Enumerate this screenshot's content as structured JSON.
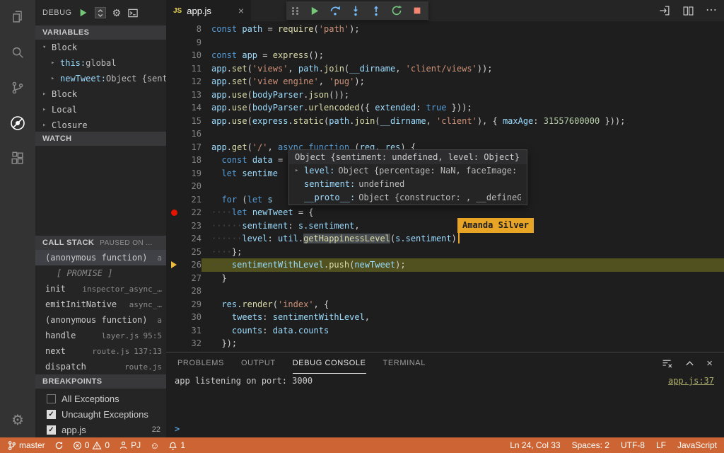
{
  "colors": {
    "status_bar_bg": "#CC6533",
    "exec_line_highlight": "#51511F",
    "collab_cursor": "#E8A425",
    "breakpoint_red": "#E51400"
  },
  "icons": {
    "gear": "⚙",
    "more": "⋯",
    "close": "×",
    "check": "✓",
    "smiley": "☺"
  },
  "sidebar": {
    "debug_title": "DEBUG",
    "variables": {
      "title": "VARIABLES",
      "rows": [
        {
          "twistie": "▾",
          "label": "Block",
          "indent": 0
        },
        {
          "twistie": "▸",
          "name": "this:",
          "value": "global",
          "indent": 1
        },
        {
          "twistie": "▸",
          "name": "newTweet:",
          "value": "Object {sent…",
          "indent": 1
        },
        {
          "twistie": "▸",
          "label": "Block",
          "indent": 0
        },
        {
          "twistie": "▸",
          "label": "Local",
          "indent": 0
        },
        {
          "twistie": "▸",
          "label": "Closure",
          "indent": 0
        }
      ]
    },
    "watch": {
      "title": "WATCH"
    },
    "call_stack": {
      "title": "CALL STACK",
      "badge": "PAUSED ON ...",
      "frames": [
        {
          "name": "(anonymous function)",
          "file": "a",
          "selected": true
        },
        {
          "name": "[ PROMISE ]",
          "promise": true
        },
        {
          "name": "init",
          "file": "inspector_async_…"
        },
        {
          "name": "emitInitNative",
          "file": "async_…"
        },
        {
          "name": "(anonymous function)",
          "file": "a"
        },
        {
          "name": "handle",
          "file": "layer.js",
          "loc": "95:5"
        },
        {
          "name": "next",
          "file": "route.js",
          "loc": "137:13"
        },
        {
          "name": "dispatch",
          "file": "route.js"
        }
      ]
    },
    "breakpoints": {
      "title": "BREAKPOINTS",
      "items": [
        {
          "checked": false,
          "label": "All Exceptions"
        },
        {
          "checked": true,
          "label": "Uncaught Exceptions"
        },
        {
          "checked": true,
          "label": "app.js",
          "badge": "22"
        }
      ]
    }
  },
  "editor": {
    "tab": {
      "icon_label": "JS",
      "title": "app.js",
      "close_label": "×"
    },
    "collab_cursor_name": "Amanda Silver",
    "tooltip": {
      "header": "Object {sentiment: undefined, level: Object}",
      "rows": [
        {
          "twistie": "▸",
          "name": "level:",
          "value": "Object {percentage: NaN, faceImage: \"/a"
        },
        {
          "name": "sentiment:",
          "value": "undefined"
        },
        {
          "name": "__proto__:",
          "value": "Object {constructor: , __defineGette"
        }
      ]
    },
    "lines": [
      {
        "num": 8,
        "tokens": [
          {
            "t": "const ",
            "c": "k"
          },
          {
            "t": "path",
            "c": "v"
          },
          {
            "t": " = ",
            "c": "p"
          },
          {
            "t": "require",
            "c": "f"
          },
          {
            "t": "(",
            "c": "p"
          },
          {
            "t": "'path'",
            "c": "s"
          },
          {
            "t": ");",
            "c": "p"
          }
        ]
      },
      {
        "num": 9,
        "tokens": []
      },
      {
        "num": 10,
        "tokens": [
          {
            "t": "const ",
            "c": "k"
          },
          {
            "t": "app",
            "c": "v"
          },
          {
            "t": " = ",
            "c": "p"
          },
          {
            "t": "express",
            "c": "f"
          },
          {
            "t": "();",
            "c": "p"
          }
        ]
      },
      {
        "num": 11,
        "tokens": [
          {
            "t": "app",
            "c": "v"
          },
          {
            "t": ".",
            "c": "p"
          },
          {
            "t": "set",
            "c": "f"
          },
          {
            "t": "(",
            "c": "p"
          },
          {
            "t": "'views'",
            "c": "s"
          },
          {
            "t": ", ",
            "c": "p"
          },
          {
            "t": "path",
            "c": "v"
          },
          {
            "t": ".",
            "c": "p"
          },
          {
            "t": "join",
            "c": "f"
          },
          {
            "t": "(",
            "c": "p"
          },
          {
            "t": "__dirname",
            "c": "v"
          },
          {
            "t": ", ",
            "c": "p"
          },
          {
            "t": "'client/views'",
            "c": "s"
          },
          {
            "t": "));",
            "c": "p"
          }
        ]
      },
      {
        "num": 12,
        "tokens": [
          {
            "t": "app",
            "c": "v"
          },
          {
            "t": ".",
            "c": "p"
          },
          {
            "t": "set",
            "c": "f"
          },
          {
            "t": "(",
            "c": "p"
          },
          {
            "t": "'view engine'",
            "c": "s"
          },
          {
            "t": ", ",
            "c": "p"
          },
          {
            "t": "'pug'",
            "c": "s"
          },
          {
            "t": ");",
            "c": "p"
          }
        ]
      },
      {
        "num": 13,
        "tokens": [
          {
            "t": "app",
            "c": "v"
          },
          {
            "t": ".",
            "c": "p"
          },
          {
            "t": "use",
            "c": "f"
          },
          {
            "t": "(",
            "c": "p"
          },
          {
            "t": "bodyParser",
            "c": "v"
          },
          {
            "t": ".",
            "c": "p"
          },
          {
            "t": "json",
            "c": "f"
          },
          {
            "t": "());",
            "c": "p"
          }
        ]
      },
      {
        "num": 14,
        "tokens": [
          {
            "t": "app",
            "c": "v"
          },
          {
            "t": ".",
            "c": "p"
          },
          {
            "t": "use",
            "c": "f"
          },
          {
            "t": "(",
            "c": "p"
          },
          {
            "t": "bodyParser",
            "c": "v"
          },
          {
            "t": ".",
            "c": "p"
          },
          {
            "t": "urlencoded",
            "c": "f"
          },
          {
            "t": "({ ",
            "c": "p"
          },
          {
            "t": "extended",
            "c": "v"
          },
          {
            "t": ": ",
            "c": "p"
          },
          {
            "t": "true",
            "c": "k"
          },
          {
            "t": " }));",
            "c": "p"
          }
        ]
      },
      {
        "num": 15,
        "tokens": [
          {
            "t": "app",
            "c": "v"
          },
          {
            "t": ".",
            "c": "p"
          },
          {
            "t": "use",
            "c": "f"
          },
          {
            "t": "(",
            "c": "p"
          },
          {
            "t": "express",
            "c": "v"
          },
          {
            "t": ".",
            "c": "p"
          },
          {
            "t": "static",
            "c": "f"
          },
          {
            "t": "(",
            "c": "p"
          },
          {
            "t": "path",
            "c": "v"
          },
          {
            "t": ".",
            "c": "p"
          },
          {
            "t": "join",
            "c": "f"
          },
          {
            "t": "(",
            "c": "p"
          },
          {
            "t": "__dirname",
            "c": "v"
          },
          {
            "t": ", ",
            "c": "p"
          },
          {
            "t": "'client'",
            "c": "s"
          },
          {
            "t": "), { ",
            "c": "p"
          },
          {
            "t": "maxAge",
            "c": "v"
          },
          {
            "t": ": ",
            "c": "p"
          },
          {
            "t": "31557600000",
            "c": "n"
          },
          {
            "t": " }));",
            "c": "p"
          }
        ]
      },
      {
        "num": 16,
        "tokens": []
      },
      {
        "num": 17,
        "tokens": [
          {
            "t": "app",
            "c": "v"
          },
          {
            "t": ".",
            "c": "p"
          },
          {
            "t": "get",
            "c": "f"
          },
          {
            "t": "(",
            "c": "p"
          },
          {
            "t": "'/'",
            "c": "s"
          },
          {
            "t": ", ",
            "c": "p"
          },
          {
            "t": "async function ",
            "c": "k"
          },
          {
            "t": "(",
            "c": "p"
          },
          {
            "t": "req",
            "c": "v"
          },
          {
            "t": ", ",
            "c": "p"
          },
          {
            "t": "res",
            "c": "v"
          },
          {
            "t": ") {",
            "c": "p"
          }
        ]
      },
      {
        "num": 18,
        "tokens": [
          {
            "t": "  ",
            "c": "p"
          },
          {
            "t": "const ",
            "c": "k"
          },
          {
            "t": "data",
            "c": "v"
          },
          {
            "t": " = ",
            "c": "p"
          }
        ]
      },
      {
        "num": 19,
        "tokens": [
          {
            "t": "  ",
            "c": "p"
          },
          {
            "t": "let ",
            "c": "k"
          },
          {
            "t": "sentime",
            "c": "v"
          }
        ]
      },
      {
        "num": 20,
        "tokens": []
      },
      {
        "num": 21,
        "tokens": [
          {
            "t": "  ",
            "c": "p"
          },
          {
            "t": "for ",
            "c": "k"
          },
          {
            "t": "(",
            "c": "p"
          },
          {
            "t": "let ",
            "c": "k"
          },
          {
            "t": "s",
            "c": "v"
          }
        ]
      },
      {
        "num": 22,
        "breakpoint": true,
        "tokens": [
          {
            "t": "····",
            "c": "w"
          },
          {
            "t": "let ",
            "c": "k"
          },
          {
            "t": "newTweet",
            "c": "v"
          },
          {
            "t": " = {",
            "c": "p"
          }
        ]
      },
      {
        "num": 23,
        "tokens": [
          {
            "t": "······",
            "c": "w"
          },
          {
            "t": "sentiment",
            "c": "v"
          },
          {
            "t": ": ",
            "c": "p"
          },
          {
            "t": "s.sentiment",
            "c": "v"
          },
          {
            "t": ",",
            "c": "p"
          }
        ]
      },
      {
        "num": 24,
        "tokens": [
          {
            "t": "······",
            "c": "w"
          },
          {
            "t": "level",
            "c": "v"
          },
          {
            "t": ": ",
            "c": "p"
          },
          {
            "t": "util",
            "c": "v"
          },
          {
            "t": ".",
            "c": "p"
          },
          {
            "t": "getHappinessLevel",
            "c": "f hl"
          },
          {
            "t": "(",
            "c": "p"
          },
          {
            "t": "s.sentiment",
            "c": "v"
          },
          {
            "t": ")",
            "c": "p"
          },
          {
            "t": "",
            "c": "cursor"
          }
        ]
      },
      {
        "num": 25,
        "tokens": [
          {
            "t": "····",
            "c": "w"
          },
          {
            "t": "};",
            "c": "p"
          }
        ]
      },
      {
        "num": 26,
        "exec": true,
        "tokens": [
          {
            "t": "····",
            "c": "w"
          },
          {
            "t": "sentimentWithLevel",
            "c": "v"
          },
          {
            "t": ".",
            "c": "p"
          },
          {
            "t": "push",
            "c": "f"
          },
          {
            "t": "(",
            "c": "p"
          },
          {
            "t": "newTweet",
            "c": "v"
          },
          {
            "t": ");",
            "c": "p"
          }
        ]
      },
      {
        "num": 27,
        "tokens": [
          {
            "t": "  }",
            "c": "p"
          }
        ]
      },
      {
        "num": 28,
        "tokens": []
      },
      {
        "num": 29,
        "tokens": [
          {
            "t": "  ",
            "c": "p"
          },
          {
            "t": "res",
            "c": "v"
          },
          {
            "t": ".",
            "c": "p"
          },
          {
            "t": "render",
            "c": "f"
          },
          {
            "t": "(",
            "c": "p"
          },
          {
            "t": "'index'",
            "c": "s"
          },
          {
            "t": ", {",
            "c": "p"
          }
        ]
      },
      {
        "num": 30,
        "tokens": [
          {
            "t": "    ",
            "c": "p"
          },
          {
            "t": "tweets",
            "c": "v"
          },
          {
            "t": ": ",
            "c": "p"
          },
          {
            "t": "sentimentWithLevel",
            "c": "v"
          },
          {
            "t": ",",
            "c": "p"
          }
        ]
      },
      {
        "num": 31,
        "tokens": [
          {
            "t": "    ",
            "c": "p"
          },
          {
            "t": "counts",
            "c": "v"
          },
          {
            "t": ": ",
            "c": "p"
          },
          {
            "t": "data.counts",
            "c": "v"
          }
        ]
      },
      {
        "num": 32,
        "tokens": [
          {
            "t": "  });",
            "c": "p"
          }
        ]
      }
    ]
  },
  "panel": {
    "tabs": [
      {
        "label": "PROBLEMS"
      },
      {
        "label": "OUTPUT"
      },
      {
        "label": "DEBUG CONSOLE",
        "active": true
      },
      {
        "label": "TERMINAL"
      }
    ],
    "console_line": "app listening on port: 3000",
    "source_link": "app.js:37",
    "prompt": ">"
  },
  "status_bar": {
    "branch": "master",
    "errors": "0",
    "warnings": "0",
    "live_share": "PJ",
    "notifications": "1",
    "ln_col": "Ln 24, Col 33",
    "indentation": "Spaces: 2",
    "encoding": "UTF-8",
    "eol": "LF",
    "language": "JavaScript"
  }
}
